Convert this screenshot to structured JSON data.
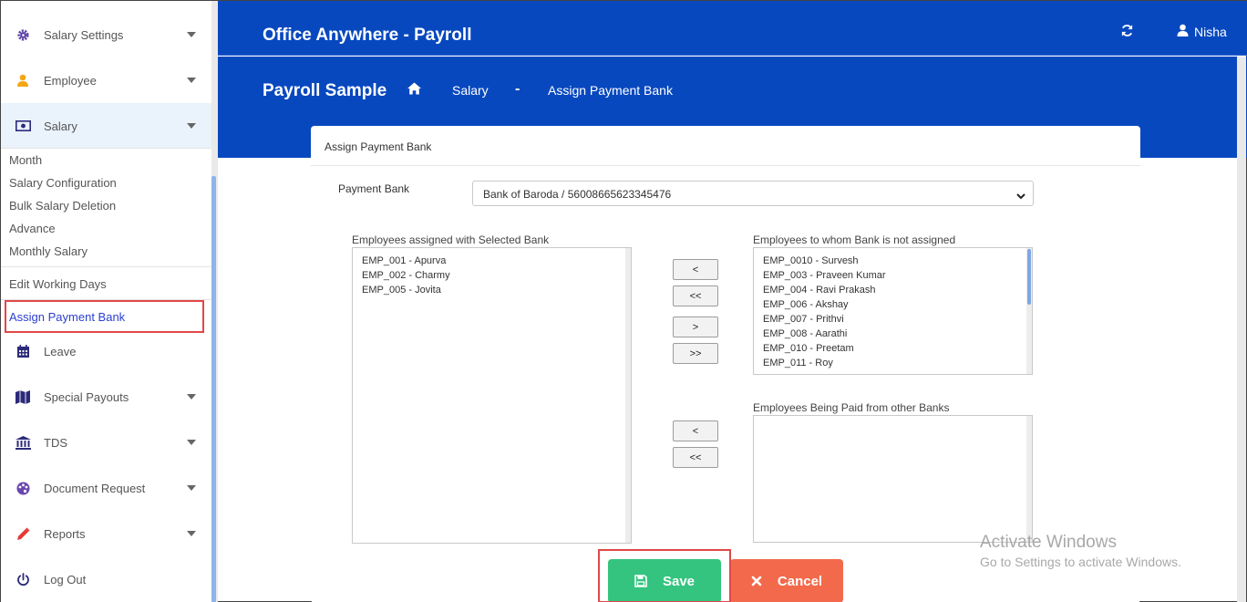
{
  "sidebar": {
    "items": [
      {
        "label": "Salary Settings",
        "icon": "gear-icon"
      },
      {
        "label": "Employee",
        "icon": "user-icon"
      },
      {
        "label": "Salary",
        "icon": "money-icon"
      },
      {
        "label": "Leave",
        "icon": "calendar-icon"
      },
      {
        "label": "Special Payouts",
        "icon": "map-icon"
      },
      {
        "label": "TDS",
        "icon": "bank-icon"
      },
      {
        "label": "Document Request",
        "icon": "palette-icon"
      },
      {
        "label": "Reports",
        "icon": "pencil-icon"
      },
      {
        "label": "Log Out",
        "icon": "power-icon"
      }
    ],
    "salary_sub": [
      "Month",
      "Salary Configuration",
      "Bulk Salary Deletion",
      "Advance",
      "Monthly Salary"
    ],
    "edit_working_days": "Edit Working Days",
    "assign_payment_bank": "Assign Payment Bank"
  },
  "header": {
    "app_title": "Office Anywhere - Payroll",
    "user_name": "Nisha",
    "page_title": "Payroll Sample",
    "breadcrumb": {
      "salary": "Salary",
      "separator": "-",
      "current": "Assign Payment Bank"
    }
  },
  "card": {
    "title": "Assign Payment Bank",
    "payment_bank_label": "Payment Bank",
    "payment_bank_value": "Bank of Baroda / 56008665623345476",
    "assigned_label": "Employees assigned with Selected Bank",
    "assigned": [
      "EMP_001 - Apurva",
      "EMP_002 - Charmy",
      "EMP_005 - Jovita"
    ],
    "not_assigned_label": "Employees to whom Bank is not assigned",
    "not_assigned": [
      "EMP_0010 - Survesh",
      "EMP_003 - Praveen Kumar",
      "EMP_004 - Ravi Prakash",
      "EMP_006 - Akshay",
      "EMP_007 - Prithvi",
      "EMP_008 - Aarathi",
      "EMP_010 - Preetam",
      "EMP_011 - Roy"
    ],
    "other_banks_label": "Employees Being Paid from other Banks",
    "other_banks": [],
    "buttons": {
      "move_left": "<",
      "move_all_left": "<<",
      "move_right": ">",
      "move_all_right": ">>",
      "other_left": "<",
      "other_all_left": "<<"
    },
    "save": "Save",
    "cancel": "Cancel"
  },
  "watermark": {
    "line1": "Activate Windows",
    "line2": "Go to Settings to activate Windows."
  },
  "colors": {
    "header_blue": "#0848bf",
    "save_green": "#34c47f",
    "cancel_orange": "#f26a4b",
    "highlight_red": "#e04848",
    "link_blue": "#2b3fd0"
  }
}
